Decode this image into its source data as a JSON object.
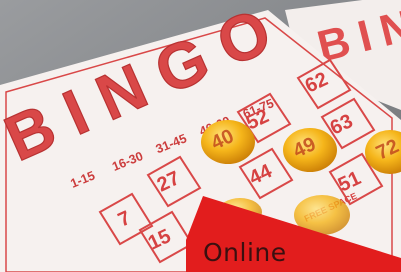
{
  "photo": {
    "card_title": "BINGO",
    "second_card_title": "BINGO",
    "column_ranges": [
      "1-15",
      "16-30",
      "31-45",
      "46-60",
      "61-75"
    ],
    "visible_numbers": [
      {
        "value": "62",
        "covered": false
      },
      {
        "value": "52",
        "covered": false
      },
      {
        "value": "63",
        "covered": false
      },
      {
        "value": "40",
        "covered": true
      },
      {
        "value": "49",
        "covered": true
      },
      {
        "value": "72",
        "covered": true
      },
      {
        "value": "27",
        "covered": false
      },
      {
        "value": "44",
        "covered": false
      },
      {
        "value": "51",
        "covered": false
      },
      {
        "value": "7",
        "covered": false
      },
      {
        "value": "15",
        "covered": false
      }
    ],
    "free_space_label": "FREE SPACE",
    "ink_color": "#d94848",
    "card_color": "#f6f1ef",
    "marker_color": "#f2b21a"
  },
  "ribbon": {
    "label": "Online",
    "color": "#e21d1d"
  }
}
